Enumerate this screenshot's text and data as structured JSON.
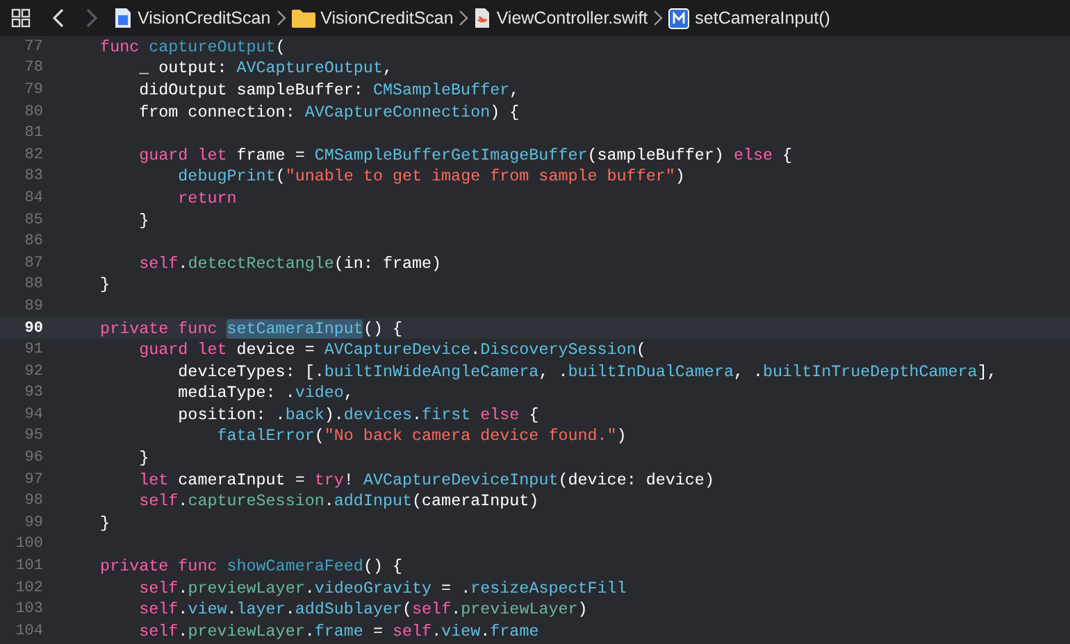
{
  "toolbar": {
    "back": {
      "disabled": false
    },
    "forward": {
      "disabled": true
    },
    "breadcrumbs": [
      {
        "kind": "project",
        "label": "VisionCreditScan"
      },
      {
        "kind": "folder",
        "label": "VisionCreditScan"
      },
      {
        "kind": "file",
        "label": "ViewController.swift"
      },
      {
        "kind": "method",
        "label": "setCameraInput()"
      }
    ]
  },
  "editor": {
    "lines": [
      {
        "number": "77",
        "current": false,
        "tokens": [
          {
            "kind": "kw",
            "text": "    func "
          },
          {
            "kind": "decl",
            "text": "captureOutput"
          },
          {
            "kind": "plain",
            "text": "("
          }
        ]
      },
      {
        "number": "78",
        "current": false,
        "tokens": [
          {
            "kind": "plain",
            "text": "        _ output: "
          },
          {
            "kind": "type",
            "text": "AVCaptureOutput"
          },
          {
            "kind": "plain",
            "text": ","
          }
        ]
      },
      {
        "number": "79",
        "current": false,
        "tokens": [
          {
            "kind": "plain",
            "text": "        didOutput sampleBuffer: "
          },
          {
            "kind": "type",
            "text": "CMSampleBuffer"
          },
          {
            "kind": "plain",
            "text": ","
          }
        ]
      },
      {
        "number": "80",
        "current": false,
        "tokens": [
          {
            "kind": "plain",
            "text": "        from connection: "
          },
          {
            "kind": "type",
            "text": "AVCaptureConnection"
          },
          {
            "kind": "plain",
            "text": ") {"
          }
        ]
      },
      {
        "number": "81",
        "current": false
      },
      {
        "number": "82",
        "current": false,
        "tokens": [
          {
            "kind": "kw",
            "text": "        guard let"
          },
          {
            "kind": "plain",
            "text": " frame = "
          },
          {
            "kind": "type",
            "text": "CMSampleBufferGetImageBuffer"
          },
          {
            "kind": "plain",
            "text": "(sampleBuffer) "
          },
          {
            "kind": "kw",
            "text": "else"
          },
          {
            "kind": "plain",
            "text": " {"
          }
        ]
      },
      {
        "number": "83",
        "current": false,
        "tokens": [
          {
            "kind": "type",
            "text": "            debugPrint"
          },
          {
            "kind": "plain",
            "text": "("
          },
          {
            "kind": "str",
            "text": "\"unable to get image from sample buffer\""
          },
          {
            "kind": "plain",
            "text": ")"
          }
        ]
      },
      {
        "number": "84",
        "current": false,
        "tokens": [
          {
            "kind": "kw",
            "text": "            return"
          }
        ]
      },
      {
        "number": "85",
        "current": false,
        "tokens": [
          {
            "kind": "plain",
            "text": "        }"
          }
        ]
      },
      {
        "number": "86",
        "current": false
      },
      {
        "number": "87",
        "current": false,
        "tokens": [
          {
            "kind": "kw",
            "text": "        self"
          },
          {
            "kind": "plain",
            "text": "."
          },
          {
            "kind": "proj",
            "text": "detectRectangle"
          },
          {
            "kind": "plain",
            "text": "(in: frame)"
          }
        ]
      },
      {
        "number": "88",
        "current": false,
        "tokens": [
          {
            "kind": "plain",
            "text": "    }"
          }
        ]
      },
      {
        "number": "89",
        "current": false
      },
      {
        "number": "90",
        "current": true,
        "tokens": [
          {
            "kind": "kw",
            "text": "    private func "
          },
          {
            "kind": "match",
            "text": "setCameraInput"
          },
          {
            "kind": "plain",
            "text": "() {"
          }
        ]
      },
      {
        "number": "91",
        "current": false,
        "tokens": [
          {
            "kind": "kw",
            "text": "        guard let"
          },
          {
            "kind": "plain",
            "text": " device = "
          },
          {
            "kind": "type",
            "text": "AVCaptureDevice"
          },
          {
            "kind": "plain",
            "text": "."
          },
          {
            "kind": "type",
            "text": "DiscoverySession"
          },
          {
            "kind": "plain",
            "text": "("
          }
        ]
      },
      {
        "number": "92",
        "current": false,
        "tokens": [
          {
            "kind": "plain",
            "text": "            deviceTypes: [."
          },
          {
            "kind": "type",
            "text": "builtInWideAngleCamera"
          },
          {
            "kind": "plain",
            "text": ", ."
          },
          {
            "kind": "type",
            "text": "builtInDualCamera"
          },
          {
            "kind": "plain",
            "text": ", ."
          },
          {
            "kind": "type",
            "text": "builtInTrueDepthCamera"
          },
          {
            "kind": "plain",
            "text": "],"
          }
        ]
      },
      {
        "number": "93",
        "current": false,
        "tokens": [
          {
            "kind": "plain",
            "text": "            mediaType: ."
          },
          {
            "kind": "type",
            "text": "video"
          },
          {
            "kind": "plain",
            "text": ","
          }
        ]
      },
      {
        "number": "94",
        "current": false,
        "tokens": [
          {
            "kind": "plain",
            "text": "            position: ."
          },
          {
            "kind": "type",
            "text": "back"
          },
          {
            "kind": "plain",
            "text": ")."
          },
          {
            "kind": "type",
            "text": "devices"
          },
          {
            "kind": "plain",
            "text": "."
          },
          {
            "kind": "type",
            "text": "first"
          },
          {
            "kind": "kw",
            "text": " else"
          },
          {
            "kind": "plain",
            "text": " {"
          }
        ]
      },
      {
        "number": "95",
        "current": false,
        "tokens": [
          {
            "kind": "type",
            "text": "                fatalError"
          },
          {
            "kind": "plain",
            "text": "("
          },
          {
            "kind": "str",
            "text": "\"No back camera device found.\""
          },
          {
            "kind": "plain",
            "text": ")"
          }
        ]
      },
      {
        "number": "96",
        "current": false,
        "tokens": [
          {
            "kind": "plain",
            "text": "        }"
          }
        ]
      },
      {
        "number": "97",
        "current": false,
        "tokens": [
          {
            "kind": "kw",
            "text": "        let"
          },
          {
            "kind": "plain",
            "text": " cameraInput = "
          },
          {
            "kind": "kw",
            "text": "try"
          },
          {
            "kind": "plain",
            "text": "! "
          },
          {
            "kind": "type",
            "text": "AVCaptureDeviceInput"
          },
          {
            "kind": "plain",
            "text": "(device: device)"
          }
        ]
      },
      {
        "number": "98",
        "current": false,
        "tokens": [
          {
            "kind": "kw",
            "text": "        self"
          },
          {
            "kind": "plain",
            "text": "."
          },
          {
            "kind": "proj",
            "text": "captureSession"
          },
          {
            "kind": "plain",
            "text": "."
          },
          {
            "kind": "type",
            "text": "addInput"
          },
          {
            "kind": "plain",
            "text": "(cameraInput)"
          }
        ]
      },
      {
        "number": "99",
        "current": false,
        "tokens": [
          {
            "kind": "plain",
            "text": "    }"
          }
        ]
      },
      {
        "number": "100",
        "current": false
      },
      {
        "number": "101",
        "current": false,
        "tokens": [
          {
            "kind": "kw",
            "text": "    private func "
          },
          {
            "kind": "decl",
            "text": "showCameraFeed"
          },
          {
            "kind": "plain",
            "text": "() {"
          }
        ]
      },
      {
        "number": "102",
        "current": false,
        "tokens": [
          {
            "kind": "kw",
            "text": "        self"
          },
          {
            "kind": "plain",
            "text": "."
          },
          {
            "kind": "proj",
            "text": "previewLayer"
          },
          {
            "kind": "plain",
            "text": "."
          },
          {
            "kind": "type",
            "text": "videoGravity"
          },
          {
            "kind": "plain",
            "text": " = ."
          },
          {
            "kind": "type",
            "text": "resizeAspectFill"
          }
        ]
      },
      {
        "number": "103",
        "current": false,
        "tokens": [
          {
            "kind": "kw",
            "text": "        self"
          },
          {
            "kind": "plain",
            "text": "."
          },
          {
            "kind": "type",
            "text": "view"
          },
          {
            "kind": "plain",
            "text": "."
          },
          {
            "kind": "type",
            "text": "layer"
          },
          {
            "kind": "plain",
            "text": "."
          },
          {
            "kind": "type",
            "text": "addSublayer"
          },
          {
            "kind": "plain",
            "text": "("
          },
          {
            "kind": "kw",
            "text": "self"
          },
          {
            "kind": "plain",
            "text": "."
          },
          {
            "kind": "proj",
            "text": "previewLayer"
          },
          {
            "kind": "plain",
            "text": ")"
          }
        ]
      },
      {
        "number": "104",
        "current": false,
        "tokens": [
          {
            "kind": "kw",
            "text": "        self"
          },
          {
            "kind": "plain",
            "text": "."
          },
          {
            "kind": "proj",
            "text": "previewLayer"
          },
          {
            "kind": "plain",
            "text": "."
          },
          {
            "kind": "type",
            "text": "frame"
          },
          {
            "kind": "plain",
            "text": " = "
          },
          {
            "kind": "kw",
            "text": "self"
          },
          {
            "kind": "plain",
            "text": "."
          },
          {
            "kind": "type",
            "text": "view"
          },
          {
            "kind": "plain",
            "text": "."
          },
          {
            "kind": "type",
            "text": "frame"
          }
        ]
      }
    ]
  }
}
